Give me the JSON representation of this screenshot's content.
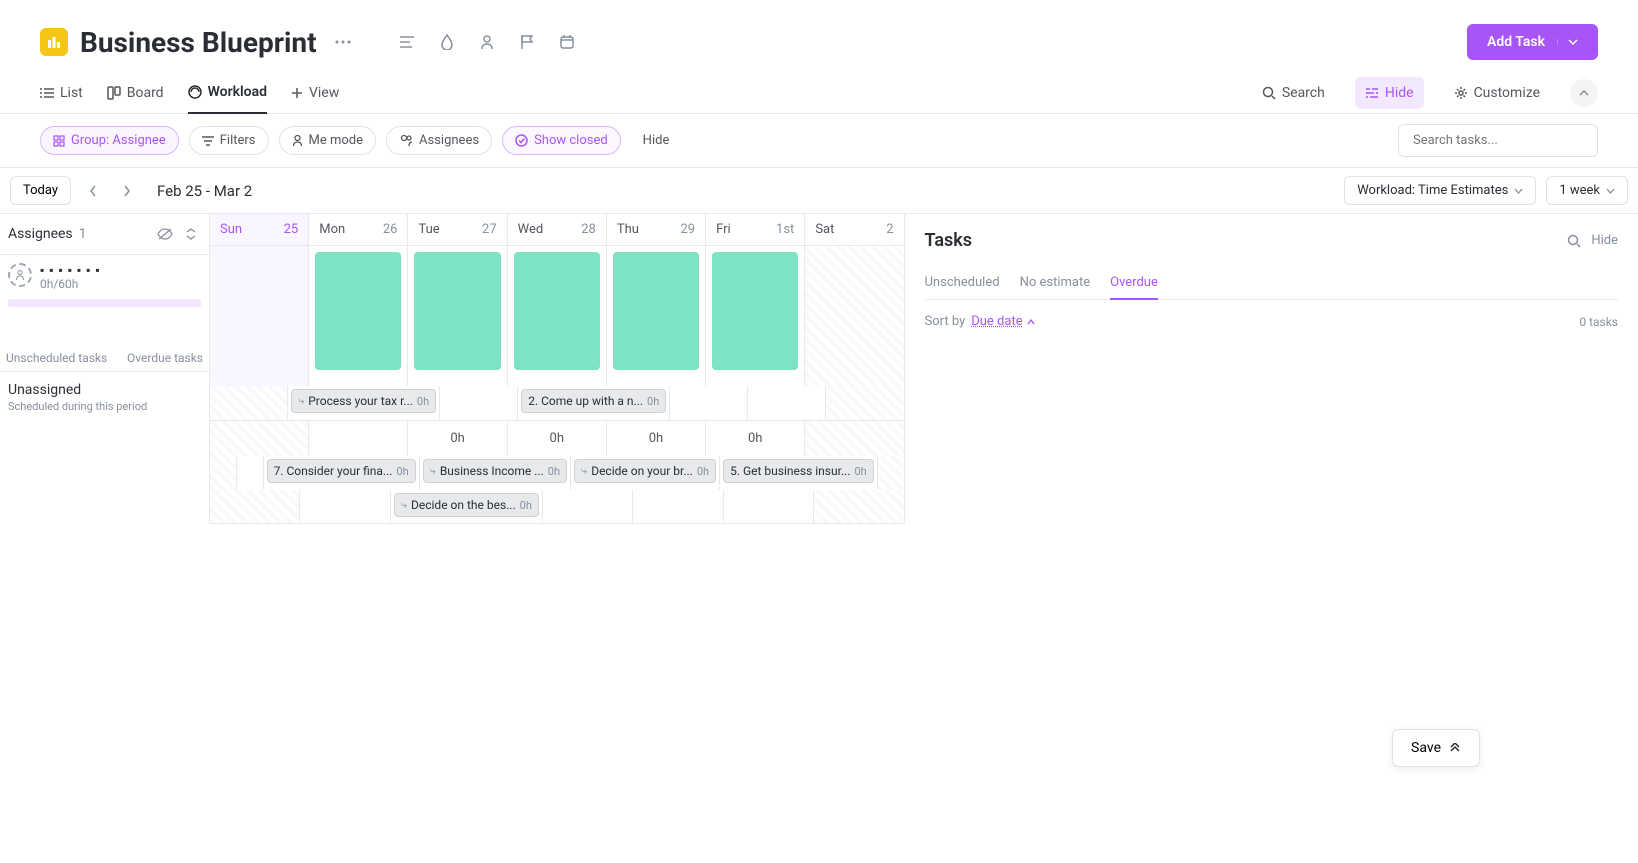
{
  "header": {
    "title": "Business Blueprint",
    "add_task": "Add Task"
  },
  "tabs": {
    "list": "List",
    "board": "Board",
    "workload": "Workload",
    "view": "View",
    "search": "Search",
    "hide": "Hide",
    "customize": "Customize"
  },
  "filters": {
    "group": "Group: Assignee",
    "filters": "Filters",
    "me": "Me mode",
    "assignees": "Assignees",
    "closed": "Show closed",
    "hide": "Hide",
    "search_placeholder": "Search tasks..."
  },
  "datenav": {
    "today": "Today",
    "range": "Feb 25 - Mar 2",
    "workload_select": "Workload: Time Estimates",
    "week_select": "1 week"
  },
  "sidebar": {
    "title": "Assignees",
    "count": "1",
    "assignee_hours": "0h/60h",
    "unscheduled": "Unscheduled tasks",
    "overdue": "Overdue tasks",
    "unassigned": "Unassigned",
    "unassigned_sub": "Scheduled during this period"
  },
  "days": [
    {
      "name": "Sun",
      "date": "25"
    },
    {
      "name": "Mon",
      "date": "26"
    },
    {
      "name": "Tue",
      "date": "27"
    },
    {
      "name": "Wed",
      "date": "28"
    },
    {
      "name": "Thu",
      "date": "29"
    },
    {
      "name": "Fri",
      "date": "1st"
    },
    {
      "name": "Sat",
      "date": "2"
    }
  ],
  "tasks_top": {
    "mon": {
      "label": "Process your tax r...",
      "hours": "0h"
    },
    "wed": {
      "label": "2. Come up with a n...",
      "hours": "0h"
    }
  },
  "hours": {
    "mon": "",
    "tue": "0h",
    "wed": "0h",
    "thu": "0h",
    "fri": "0h"
  },
  "tasks_bottom_r1": {
    "tue": {
      "label": "7. Consider your fina...",
      "hours": "0h"
    },
    "wed": {
      "label": "Business Income ...",
      "hours": "0h"
    },
    "thu": {
      "label": "Decide on your br...",
      "hours": "0h"
    },
    "fri": {
      "label": "5. Get business insur...",
      "hours": "0h"
    }
  },
  "tasks_bottom_r2": {
    "tue": {
      "label": "Decide on the bes...",
      "hours": "0h"
    }
  },
  "rightpanel": {
    "title": "Tasks",
    "hide": "Hide",
    "tabs": {
      "unscheduled": "Unscheduled",
      "noestimate": "No estimate",
      "overdue": "Overdue"
    },
    "sort_label": "Sort by",
    "sort_value": "Due date",
    "count": "0 tasks"
  },
  "save": "Save"
}
